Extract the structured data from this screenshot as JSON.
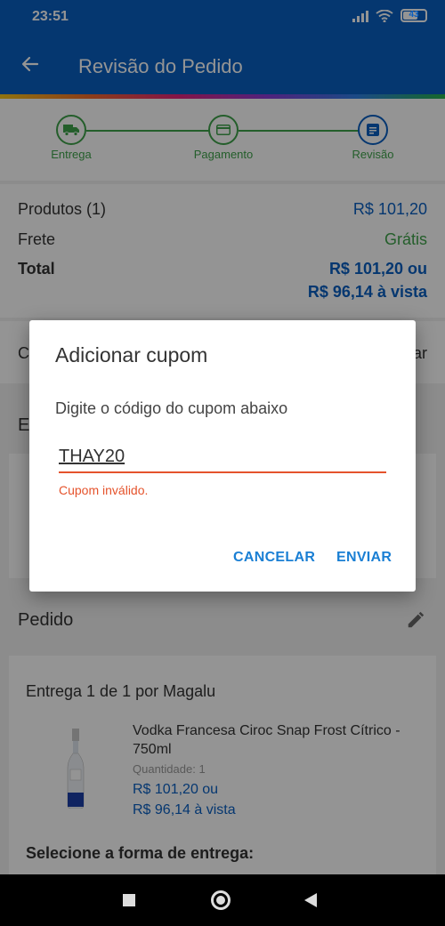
{
  "status_bar": {
    "time": "23:51",
    "battery": "43"
  },
  "app_bar": {
    "title": "Revisão do Pedido"
  },
  "stepper": {
    "steps": [
      {
        "label": "Entrega"
      },
      {
        "label": "Pagamento"
      },
      {
        "label": "Revisão"
      }
    ]
  },
  "summary": {
    "produtos_label": "Produtos (1)",
    "produtos_value": "R$ 101,20",
    "frete_label": "Frete",
    "frete_value": "Grátis",
    "total_label": "Total",
    "total_value_1": "R$ 101,20 ou",
    "total_value_2": "R$ 96,14 à vista"
  },
  "coupon_row": {
    "label": "C",
    "link": "ar"
  },
  "entrega": {
    "title": "E"
  },
  "pedido": {
    "title": "Pedido",
    "delivery_title": "Entrega 1 de 1 por Magalu",
    "product_name": "Vodka Francesa Ciroc Snap Frost Cítrico - 750ml",
    "quantity": "Quantidade:  1",
    "price_1": "R$ 101,20 ou",
    "price_2": "R$ 96,14 à vista",
    "select_delivery": "Selecione a forma de entrega:"
  },
  "dialog": {
    "title": "Adicionar cupom",
    "message": "Digite o código do cupom abaixo",
    "input_value": "THAY20",
    "error": "Cupom inválido.",
    "cancel_label": "CANCELAR",
    "send_label": "ENVIAR"
  },
  "colors": {
    "brand_blue": "#0a5fc2",
    "success_green": "#3fa34a",
    "error_orange": "#e5532c",
    "action_blue": "#1a7fd4"
  }
}
